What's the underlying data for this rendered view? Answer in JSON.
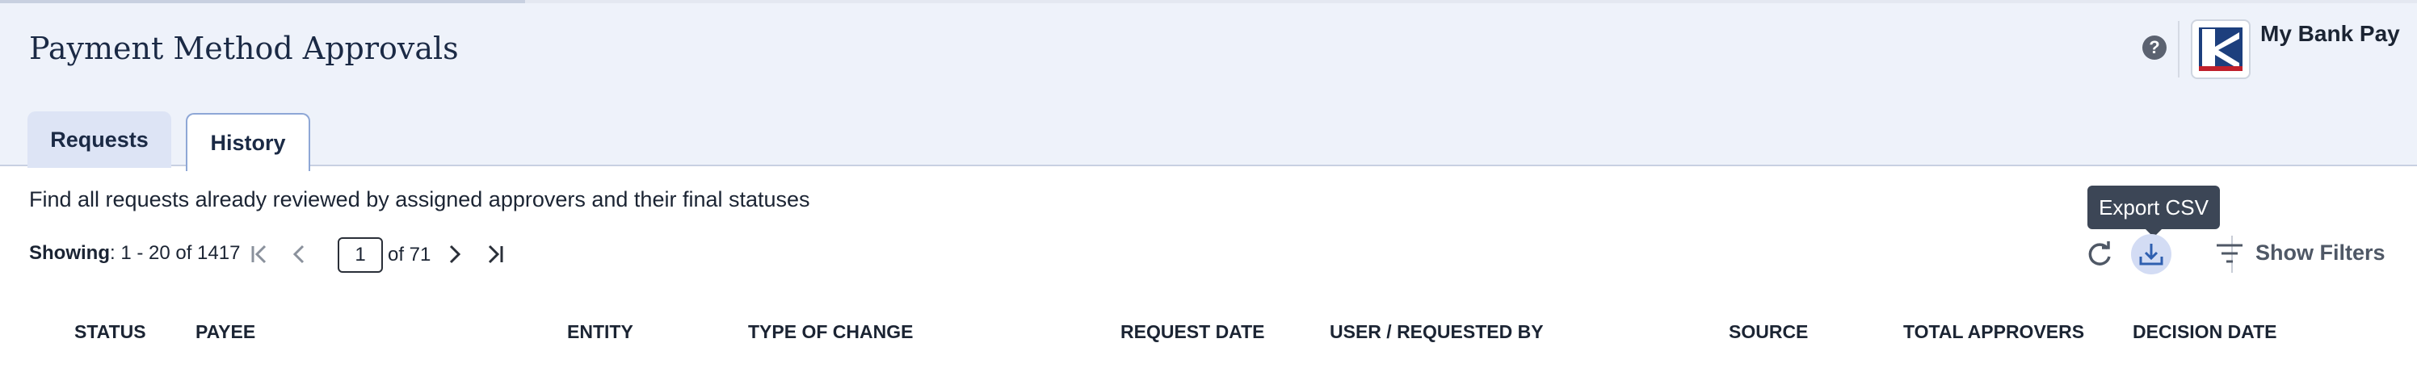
{
  "header": {
    "title": "Payment Method Approvals",
    "brand_name": "My Bank Pay",
    "help_glyph": "?"
  },
  "tabs": [
    {
      "label": "Requests",
      "active": false
    },
    {
      "label": "History",
      "active": true
    }
  ],
  "description": "Find all requests already reviewed by assigned approvers and their final statuses",
  "pagination": {
    "showing_label": "Showing",
    "showing_range": ": 1 - 20 of 1417",
    "current_page": "1",
    "of_pages": "of 71"
  },
  "toolbar": {
    "tooltip": "Export CSV",
    "show_filters_label": "Show Filters"
  },
  "table": {
    "columns": [
      "STATUS",
      "PAYEE",
      "ENTITY",
      "TYPE OF CHANGE",
      "REQUEST DATE",
      "USER / REQUESTED BY",
      "SOURCE",
      "TOTAL APPROVERS",
      "DECISION DATE"
    ]
  },
  "colors": {
    "header_bg": "#eef2fa",
    "title": "#1b2a45",
    "active_tab_border": "#8ea7d6",
    "export_highlight": "#d3dcf4",
    "tooltip_bg": "#3c4656"
  },
  "icons": [
    "help-icon",
    "bank-logo-icon",
    "first-page-icon",
    "prev-page-icon",
    "next-page-icon",
    "last-page-icon",
    "refresh-icon",
    "download-icon",
    "filter-icon"
  ]
}
